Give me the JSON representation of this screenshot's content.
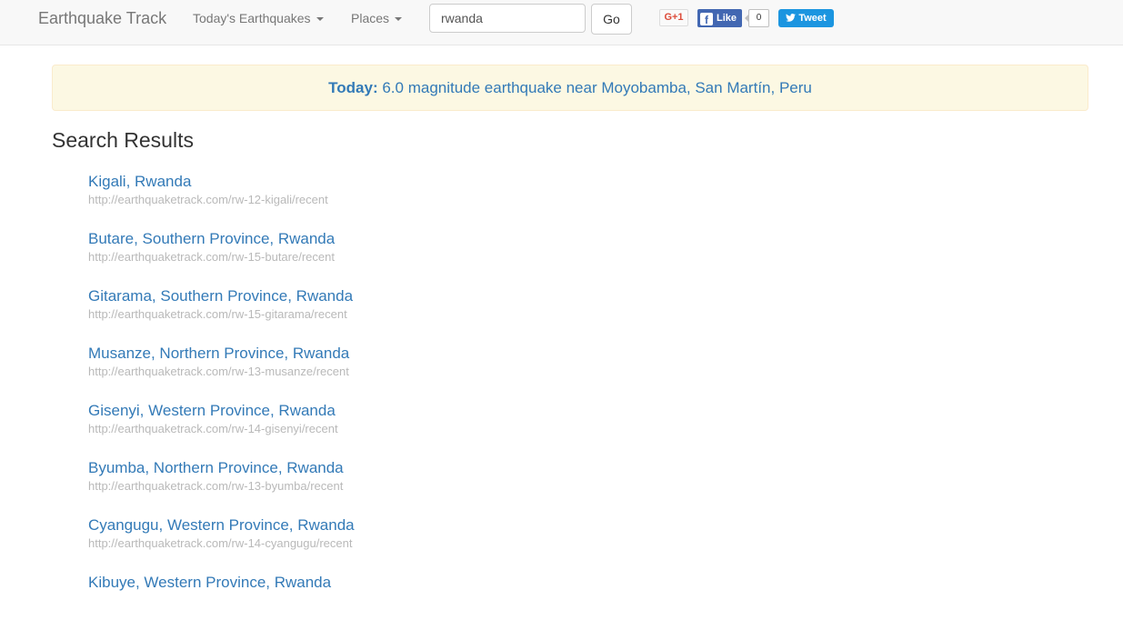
{
  "navbar": {
    "brand": "Earthquake Track",
    "menu_todays": "Today's Earthquakes",
    "menu_places": "Places",
    "search_value": "rwanda",
    "go_label": "Go",
    "social": {
      "gplus": "G+1",
      "fb_logo": "f",
      "fb_like": "Like",
      "fb_count": "0",
      "tweet": "Tweet"
    }
  },
  "alert": {
    "prefix": "Today:",
    "text": "6.0 magnitude earthquake near Moyobamba, San Martín, Peru"
  },
  "page_title": "Search Results",
  "results": [
    {
      "title": "Kigali, Rwanda",
      "url": "http://earthquaketrack.com/rw-12-kigali/recent"
    },
    {
      "title": "Butare, Southern Province, Rwanda",
      "url": "http://earthquaketrack.com/rw-15-butare/recent"
    },
    {
      "title": "Gitarama, Southern Province, Rwanda",
      "url": "http://earthquaketrack.com/rw-15-gitarama/recent"
    },
    {
      "title": "Musanze, Northern Province, Rwanda",
      "url": "http://earthquaketrack.com/rw-13-musanze/recent"
    },
    {
      "title": "Gisenyi, Western Province, Rwanda",
      "url": "http://earthquaketrack.com/rw-14-gisenyi/recent"
    },
    {
      "title": "Byumba, Northern Province, Rwanda",
      "url": "http://earthquaketrack.com/rw-13-byumba/recent"
    },
    {
      "title": "Cyangugu, Western Province, Rwanda",
      "url": "http://earthquaketrack.com/rw-14-cyangugu/recent"
    },
    {
      "title": "Kibuye, Western Province, Rwanda",
      "url": ""
    }
  ]
}
